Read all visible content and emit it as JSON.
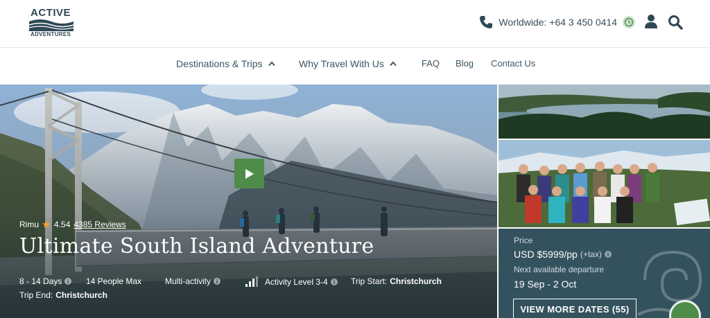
{
  "header": {
    "logo_top": "ACTIVE",
    "logo_bottom": "ADVENTURES",
    "phone_label": "Worldwide: +64 3 450 0414"
  },
  "nav": {
    "items": [
      {
        "label": "Destinations & Trips"
      },
      {
        "label": "Why Travel With Us"
      },
      {
        "label": "FAQ"
      },
      {
        "label": "Blog"
      },
      {
        "label": "Contact Us"
      }
    ]
  },
  "hero": {
    "guide_name": "Rimu",
    "rating": "4.54",
    "reviews": "4385 Reviews",
    "title": "Ultimate South Island Adventure",
    "facts": {
      "duration": "8 - 14 Days",
      "group_size": "14 People Max",
      "style": "Multi-activity",
      "activity_level": "Activity Level 3-4",
      "trip_start_label": "Trip Start:",
      "trip_start_value": "Christchurch",
      "trip_end_label": "Trip End:",
      "trip_end_value": "Christchurch"
    }
  },
  "side": {
    "price_label": "Price",
    "price_value": "USD $5999/pp",
    "price_tax": "(+tax)",
    "departure_label": "Next available departure",
    "departure_value": "19 Sep - 2 Oct",
    "dates_button": "VIEW MORE DATES (55)"
  },
  "icons": {
    "phone": "phone-icon",
    "clock": "clock-icon",
    "user": "user-icon",
    "search": "search-icon",
    "play": "play-icon",
    "star": "star-icon",
    "chat": "chat-icon"
  },
  "colors": {
    "brand_dark": "#2f4856",
    "brand_green": "#4f8c4a",
    "price_panel": "#34525e",
    "star": "#f0a030"
  }
}
